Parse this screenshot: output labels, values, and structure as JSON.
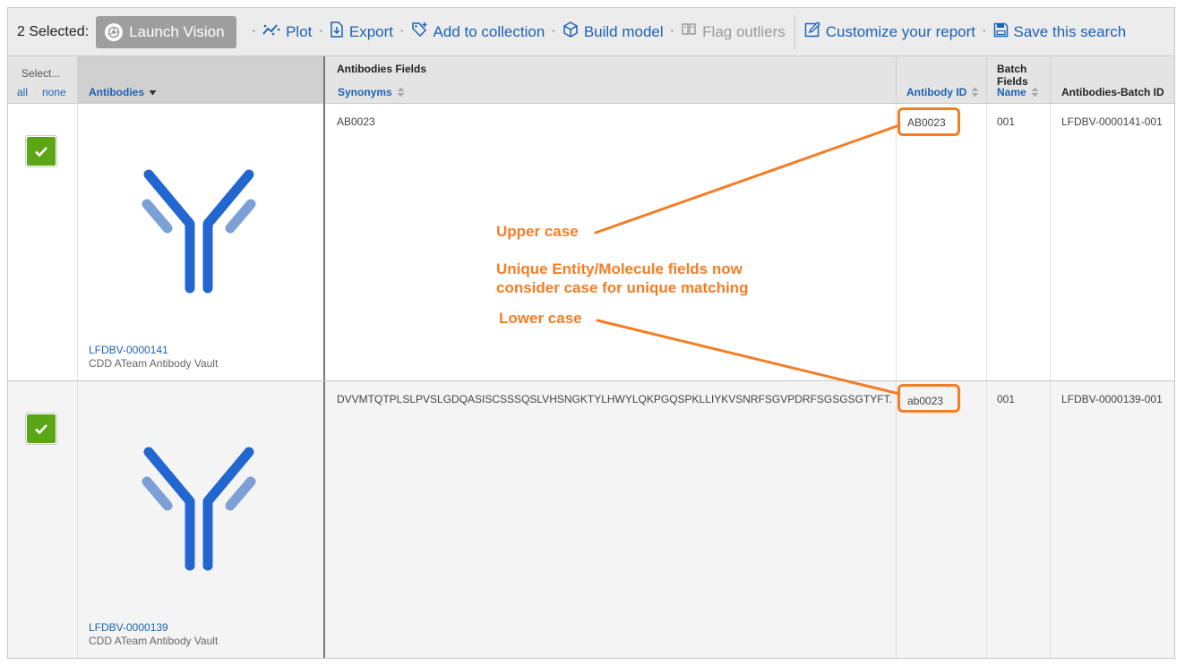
{
  "toolbar": {
    "selected_label": "2 Selected:",
    "launch_vision": "Launch Vision",
    "plot": "Plot",
    "export": "Export",
    "add_to_collection": "Add to collection",
    "build_model": "Build model",
    "flag_outliers": "Flag outliers",
    "customize_report": "Customize your report",
    "save_search": "Save this search"
  },
  "header": {
    "select": "Select...",
    "all": "all",
    "none": "none",
    "antibodies": "Antibodies",
    "antibodies_fields": "Antibodies Fields",
    "synonyms": "Synonyms",
    "antibody_id": "Antibody ID",
    "batch_fields": "Batch Fields",
    "name": "Name",
    "batch_id": "Antibodies-Batch ID"
  },
  "rows": [
    {
      "selected": true,
      "entity_id": "LFDBV-0000141",
      "vault": "CDD ATeam Antibody Vault",
      "synonyms": "AB0023",
      "antibody_id": "AB0023",
      "name": "001",
      "batch_id": "LFDBV-0000141-001"
    },
    {
      "selected": true,
      "entity_id": "LFDBV-0000139",
      "vault": "CDD ATeam Antibody Vault",
      "synonyms": "DVVMTQTPLSLPVSLGDQASISCSSSQSLVHSNGKTYLHWYLQKPGQSPKLLIYKVSNRFSGVPDRFSGSGSGTYFT...",
      "antibody_id": "ab0023",
      "name": "001",
      "batch_id": "LFDBV-0000139-001"
    }
  ],
  "annotations": {
    "upper": "Upper case",
    "middle_line1": "Unique Entity/Molecule fields now",
    "middle_line2": "consider case for unique matching",
    "lower": "Lower case",
    "accent_color": "#f47d25"
  },
  "colors": {
    "link": "#1b62b5",
    "check_green": "#5aa615",
    "antibody_dark": "#2266d0",
    "antibody_light": "#7c9fd6"
  }
}
